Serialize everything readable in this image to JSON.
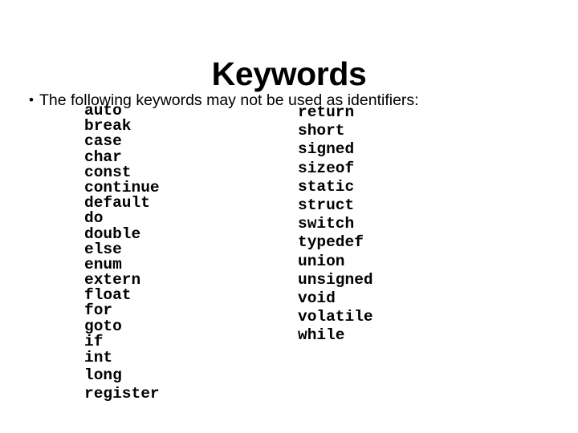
{
  "slide": {
    "title": "Keywords",
    "bullet_glyph": "•",
    "bullet_text": "The following keywords may not be used as identifiers:",
    "background_color": "#ffffff",
    "text_color": "#000000",
    "columns": [
      {
        "name": "keywords-column-left",
        "items": [
          "auto",
          "break",
          "case",
          "char",
          "const",
          "continue",
          "default",
          "do",
          "double",
          "else",
          "enum",
          "extern",
          "float",
          "for",
          "goto",
          "if",
          "int",
          "long",
          "register"
        ]
      },
      {
        "name": "keywords-column-right",
        "items": [
          "return",
          "short",
          "signed",
          "sizeof",
          "static",
          "struct",
          "switch",
          "typedef",
          "union",
          "unsigned",
          "void",
          "volatile",
          "while"
        ]
      }
    ]
  }
}
